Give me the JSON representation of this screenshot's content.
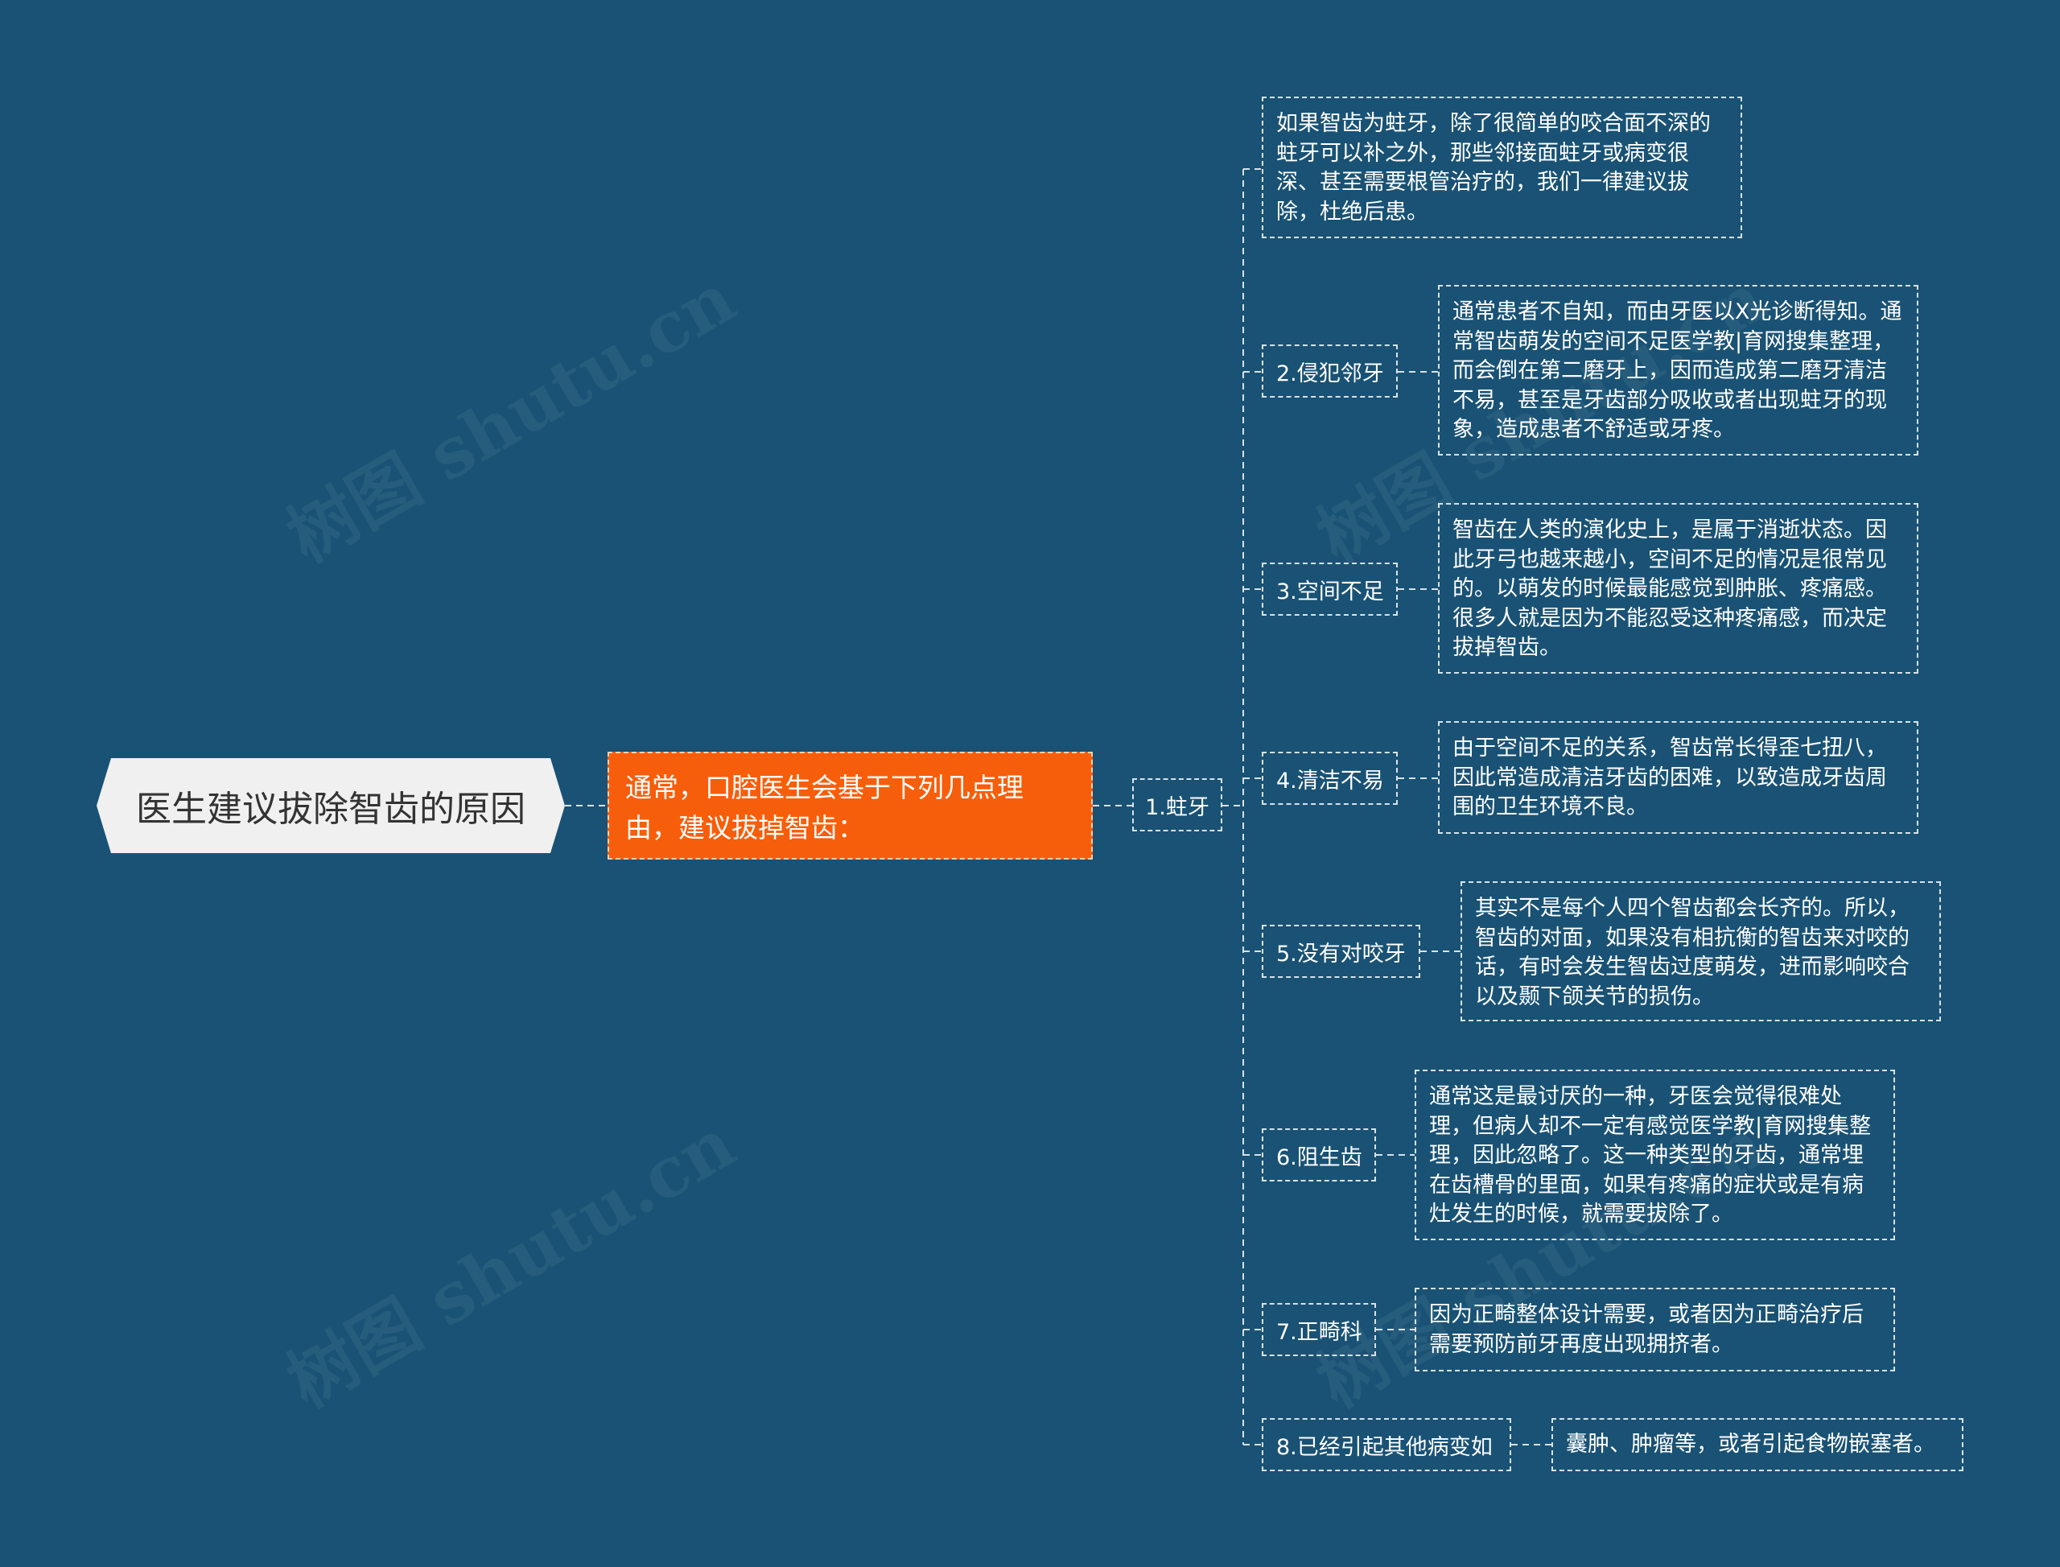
{
  "title": "医生建议拔除智齿的原因",
  "intro": "通常，口腔医生会基于下列几点理由，建议拔掉智齿：",
  "first_item": "1.蛀牙",
  "watermark": "树图 shutu.cn",
  "colors": {
    "background": "#195274",
    "main_node": "#f75e0b",
    "root_node": "#f0f0f0",
    "connector": "#d8e2ea"
  },
  "branches": [
    {
      "label": "",
      "text": "如果智齿为蛀牙，除了很简单的咬合面不深的蛀牙可以补之外，那些邻接面蛀牙或病变很深、甚至需要根管治疗的，我们一律建议拔除，杜绝后患。"
    },
    {
      "label": "2.侵犯邻牙",
      "text": "通常患者不自知，而由牙医以X光诊断得知。通常智齿萌发的空间不足医学教|育网搜集整理，而会倒在第二磨牙上，因而造成第二磨牙清洁不易，甚至是牙齿部分吸收或者出现蛀牙的现象，造成患者不舒适或牙疼。"
    },
    {
      "label": "3.空间不足",
      "text": "智齿在人类的演化史上，是属于消逝状态。因此牙弓也越来越小，空间不足的情况是很常见的。以萌发的时候最能感觉到肿胀、疼痛感。很多人就是因为不能忍受这种疼痛感，而决定拔掉智齿。"
    },
    {
      "label": "4.清洁不易",
      "text": "由于空间不足的关系，智齿常长得歪七扭八，因此常造成清洁牙齿的困难，以致造成牙齿周围的卫生环境不良。"
    },
    {
      "label": "5.没有对咬牙",
      "text": "其实不是每个人四个智齿都会长齐的。所以，智齿的对面，如果没有相抗衡的智齿来对咬的话，有时会发生智齿过度萌发，进而影响咬合以及颞下颌关节的损伤。"
    },
    {
      "label": "6.阻生齿",
      "text": "通常这是最讨厌的一种，牙医会觉得很难处理，但病人却不一定有感觉医学教|育网搜集整理，因此忽略了。这一种类型的牙齿，通常埋在齿槽骨的里面，如果有疼痛的症状或是有病灶发生的时候，就需要拔除了。"
    },
    {
      "label": "7.正畸科",
      "text": "因为正畸整体设计需要，或者因为正畸治疗后需要预防前牙再度出现拥挤者。"
    },
    {
      "label": "8.已经引起其他病变如",
      "text": "囊肿、肿瘤等，或者引起食物嵌塞者。"
    }
  ]
}
